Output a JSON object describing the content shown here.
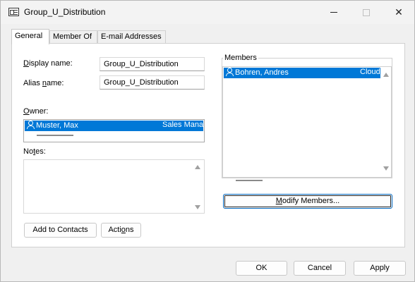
{
  "window": {
    "title": "Group_U_Distribution"
  },
  "tabs": [
    "General",
    "Member Of",
    "E-mail Addresses"
  ],
  "general": {
    "display_name_label_u": "D",
    "display_name_label_rest": "isplay name:",
    "display_name_value": "Group_U_Distribution",
    "alias_label_pre": "Alias ",
    "alias_label_u": "n",
    "alias_label_rest": "ame:",
    "alias_value": "Group_U_Distribution",
    "owner_label_u": "O",
    "owner_label_rest": "wner:",
    "owner": {
      "name": "Muster, Max",
      "title": "Sales Mana"
    },
    "notes_label_pre": "No",
    "notes_label_u": "t",
    "notes_label_rest": "es:",
    "notes_value": "",
    "add_to_contacts_label": "Add to Contacts",
    "actions_label_pre": "Acti",
    "actions_label_u": "o",
    "actions_label_rest": "ns"
  },
  "members": {
    "group_label": "Members",
    "items": [
      {
        "name": "Bohren, Andres",
        "detail": "Cloud"
      }
    ],
    "modify_label_u": "M",
    "modify_label_rest": "odify Members..."
  },
  "footer": {
    "ok_label": "OK",
    "cancel_label": "Cancel",
    "apply_label": "Apply"
  },
  "icons": {
    "app": "contact-card-icon",
    "person": "person-icon"
  },
  "colors": {
    "selection": "#0078d7",
    "focus_border": "#0067c0"
  }
}
